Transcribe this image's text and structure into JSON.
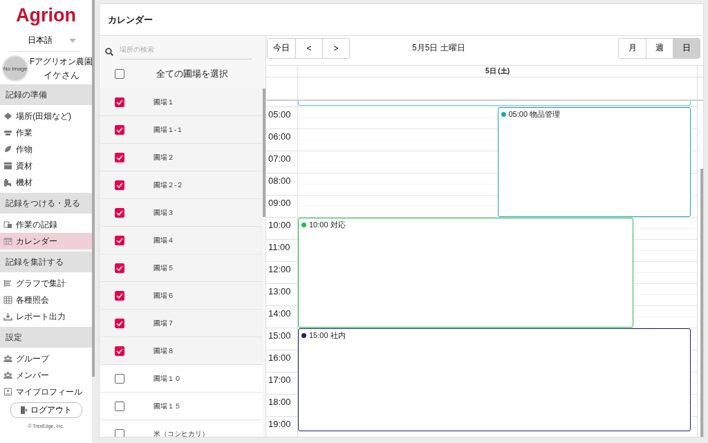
{
  "sidebar": {
    "logo": "Agrion",
    "language": "日本語",
    "profile": {
      "avatar_text": "No Image",
      "farm": "Fアグリオン農園",
      "user": "イケさん"
    },
    "sections": [
      {
        "title": "記録の準備",
        "items": [
          {
            "label": "場所(田畑など)",
            "selected": false
          },
          {
            "label": "作業",
            "selected": false
          },
          {
            "label": "作物",
            "selected": false
          },
          {
            "label": "資材",
            "selected": false
          },
          {
            "label": "機材",
            "selected": false
          }
        ]
      },
      {
        "title": "記録をつける・見る",
        "items": [
          {
            "label": "作業の記録",
            "selected": false
          },
          {
            "label": "カレンダー",
            "selected": true
          }
        ]
      },
      {
        "title": "記録を集計する",
        "items": [
          {
            "label": "グラフで集計",
            "selected": false
          },
          {
            "label": "各種照会",
            "selected": false
          },
          {
            "label": "レポート出力",
            "selected": false
          }
        ]
      },
      {
        "title": "設定",
        "items": [
          {
            "label": "グループ",
            "selected": false
          },
          {
            "label": "メンバー",
            "selected": false
          },
          {
            "label": "マイプロフィール",
            "selected": false
          }
        ]
      }
    ],
    "logout": "ログアウト",
    "copyright": "© TrexEdge, Inc."
  },
  "page_title": "カレンダー",
  "fields_panel": {
    "search": {
      "placeholder": "場所の検索"
    },
    "select_all": {
      "label": "全ての圃場を選択",
      "checked": false
    },
    "fields": [
      {
        "name": "圃場１",
        "checked": true
      },
      {
        "name": "圃場１-１",
        "checked": true
      },
      {
        "name": "圃場２",
        "checked": true
      },
      {
        "name": "圃場２-２",
        "checked": true
      },
      {
        "name": "圃場３",
        "checked": true
      },
      {
        "name": "圃場４",
        "checked": true
      },
      {
        "name": "圃場５",
        "checked": true
      },
      {
        "name": "圃場６",
        "checked": true
      },
      {
        "name": "圃場７",
        "checked": true
      },
      {
        "name": "圃場８",
        "checked": true
      },
      {
        "name": "圃場１０",
        "checked": false
      },
      {
        "name": "圃場１５",
        "checked": false
      },
      {
        "name": "米（コシヒカリ）",
        "checked": false
      }
    ]
  },
  "calendar": {
    "nav": [
      "今日",
      "<",
      ">"
    ],
    "title": "5月5日 土曜日",
    "views": [
      {
        "label": "月",
        "selected": false
      },
      {
        "label": "週",
        "selected": false
      },
      {
        "label": "日",
        "selected": true
      }
    ],
    "day_header": "5日 (土)",
    "hours": [
      "05:00",
      "06:00",
      "07:00",
      "08:00",
      "09:00",
      "10:00",
      "11:00",
      "12:00",
      "13:00",
      "14:00",
      "15:00",
      "16:00",
      "17:00",
      "18:00",
      "19:00"
    ],
    "events": [
      {
        "time": "05:00",
        "title": "物品管理",
        "kind": "right",
        "color": "#1aa6b7"
      },
      {
        "time": "10:00",
        "title": "対応",
        "kind": "left",
        "color": "#22bb4e"
      },
      {
        "time": "15:00",
        "title": "社内",
        "kind": "full",
        "color": "#1b1f6b"
      }
    ]
  }
}
